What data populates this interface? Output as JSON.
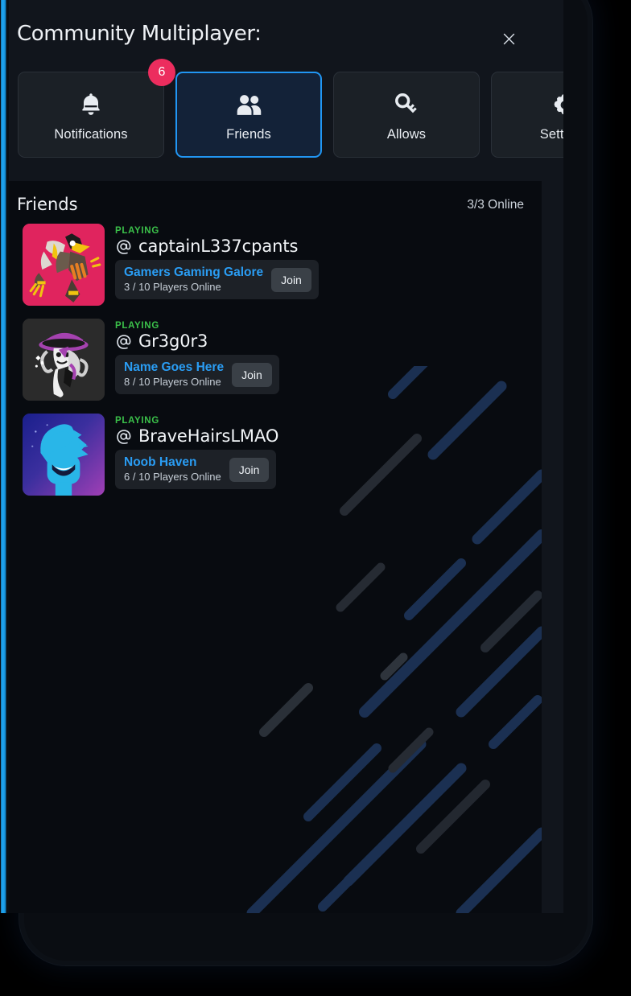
{
  "header": {
    "title": "Community Multiplayer:",
    "close_icon": "close-icon",
    "close_label": "Close"
  },
  "tabs": [
    {
      "label": "Notifications",
      "icon": "bell-icon",
      "active": false,
      "badge": "6"
    },
    {
      "label": "Friends",
      "icon": "people-icon",
      "active": true,
      "badge": ""
    },
    {
      "label": "Allows",
      "icon": "key-icon",
      "active": false,
      "badge": ""
    },
    {
      "label": "Settings",
      "icon": "gear-icon",
      "active": false,
      "badge": ""
    }
  ],
  "friends_panel": {
    "title": "Friends",
    "online_count": "3/3 Online",
    "status_label": "PLAYING",
    "at_symbol": "@",
    "join_label": "Join",
    "friends": [
      {
        "handle": "captainL337cpants",
        "status": "PLAYING",
        "game": "Gamers Gaming Galore",
        "players": "3 / 10 Players Online",
        "join": "Join",
        "avatar": "creature-avatar"
      },
      {
        "handle": "Gr3g0r3",
        "status": "PLAYING",
        "game": "Name Goes Here",
        "players": "8 / 10 Players Online",
        "join": "Join",
        "avatar": "witch-ghost-avatar"
      },
      {
        "handle": "BraveHairsLMAO",
        "status": "PLAYING",
        "game": "Noob Haven",
        "players": "6 / 10 Players Online",
        "join": "Join",
        "avatar": "blue-character-avatar"
      }
    ]
  },
  "colors": {
    "accent_blue": "#2196f3",
    "badge_pink": "#ec2d5e",
    "playing_green": "#3bc14a",
    "game_link_blue": "#2a9df4",
    "panel_bg": "#11151c",
    "content_bg": "#080b10",
    "rail_blue": "#29b6f6"
  }
}
